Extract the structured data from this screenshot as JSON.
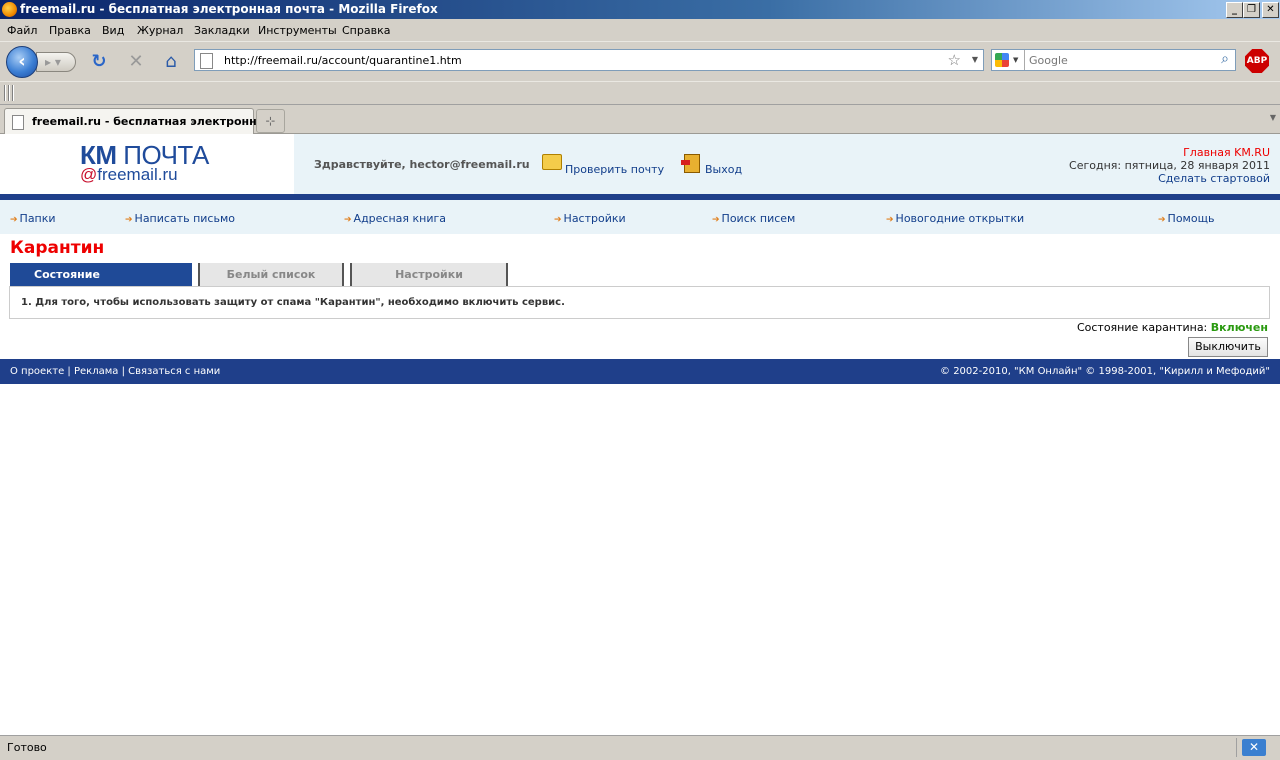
{
  "window": {
    "title": "freemail.ru - бесплатная электронная почта - Mozilla Firefox",
    "controls": {
      "minimize": "_",
      "restore": "❐",
      "close": "✕"
    }
  },
  "menu": [
    "Файл",
    "Правка",
    "Вид",
    "Журнал",
    "Закладки",
    "Инструменты",
    "Справка"
  ],
  "toolbar": {
    "url": "http://freemail.ru/account/quarantine1.htm",
    "search_placeholder": "Google",
    "adblock_label": "ABP"
  },
  "tabs": [
    {
      "label": "freemail.ru - бесплатная электронн...",
      "active": true
    }
  ],
  "header": {
    "logo_brand": "КМ",
    "logo_product": "ПОЧТА",
    "logo_at": "@",
    "logo_domain": "freemail.ru",
    "greeting": "Здравствуйте, hector@freemail.ru",
    "check_mail": "Проверить почту",
    "logout": "Выход",
    "home_link": "Главная KM.RU",
    "date_text": "Сегодня: пятница, 28 января 2011",
    "make_start": "Сделать стартовой"
  },
  "nav": [
    "Папки",
    "Написать письмо",
    "Адресная книга",
    "Настройки",
    "Поиск писем",
    "Новогодние открытки",
    "Помощь"
  ],
  "page": {
    "title": "Карантин",
    "tabs": [
      "Состояние",
      "Белый список",
      "Настройки"
    ],
    "message": "1. Для того, чтобы использовать защиту от спама \"Карантин\", необходимо включить сервис.",
    "status_label": "Состояние карантина:",
    "status_value": "Включен",
    "toggle_button": "Выключить"
  },
  "footer": {
    "links": [
      "О проекте",
      "Реклама",
      "Связаться с нами"
    ],
    "separator": "|",
    "copyright": "© 2002-2010, \"КМ Онлайн\" © 1998-2001, \"Кирилл и Мефодий\""
  },
  "statusbar": {
    "text": "Готово"
  },
  "colors": {
    "brand_blue": "#1f3f8a",
    "title_red": "#e00000",
    "status_green": "#2a9a10",
    "link": "#123e8b"
  },
  "icons": [
    "firefox-icon",
    "back-arrow-icon",
    "forward-arrow-icon",
    "reload-icon",
    "stop-icon",
    "home-icon",
    "page-icon",
    "bookmark-star-icon",
    "google-icon",
    "magnifier-icon",
    "envelope-icon",
    "exit-door-icon"
  ]
}
